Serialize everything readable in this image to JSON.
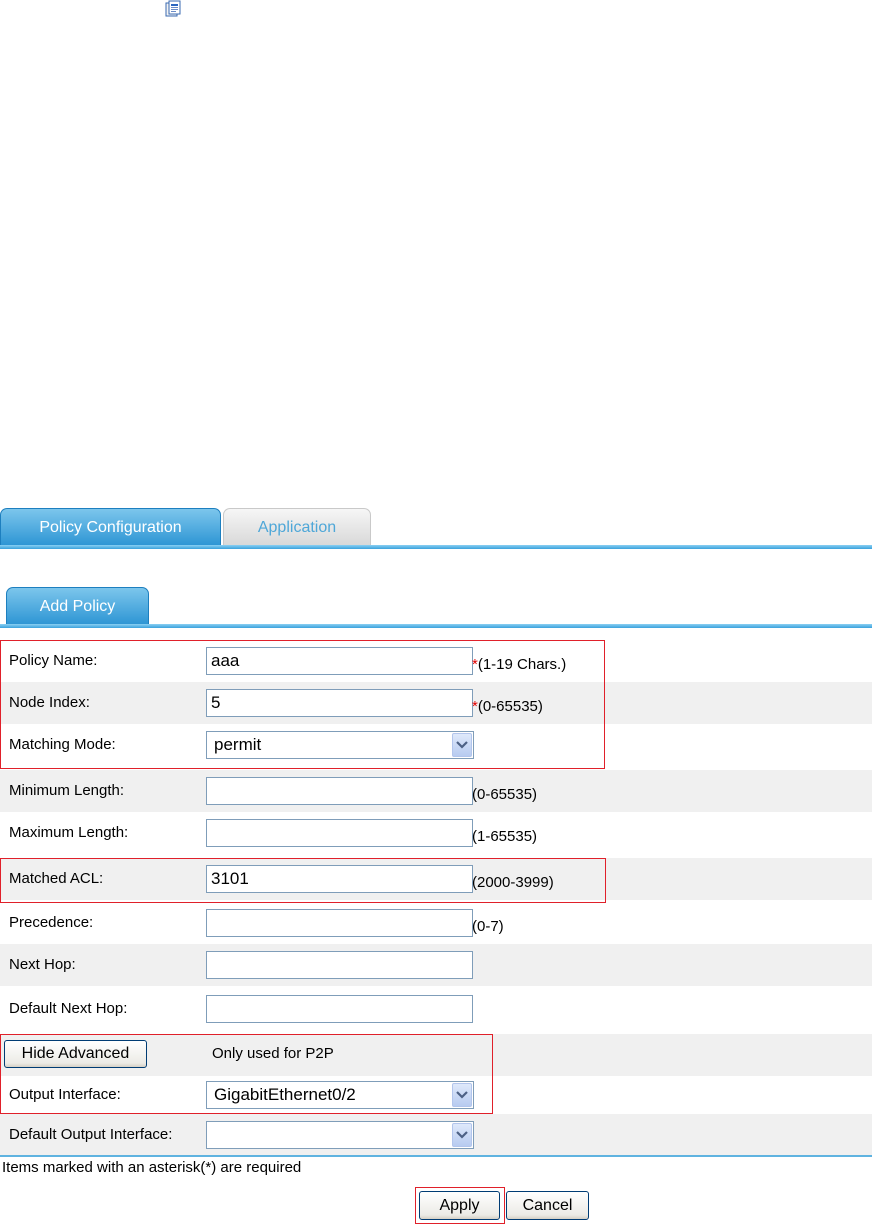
{
  "tabs": [
    {
      "label": "Policy Configuration",
      "active": true
    },
    {
      "label": "Application",
      "active": false
    }
  ],
  "subtab": {
    "label": "Add Policy"
  },
  "form": {
    "policy_name": {
      "label": "Policy Name:",
      "value": "aaa",
      "required_mark": "*",
      "hint": "(1-19 Chars.)"
    },
    "node_index": {
      "label": "Node Index:",
      "value": "5",
      "required_mark": "*",
      "hint": "(0-65535)"
    },
    "matching_mode": {
      "label": "Matching Mode:",
      "value": "permit"
    },
    "minimum_length": {
      "label": "Minimum Length:",
      "value": "",
      "hint": "(0-65535)"
    },
    "maximum_length": {
      "label": "Maximum Length:",
      "value": "",
      "hint": "(1-65535)"
    },
    "matched_acl": {
      "label": "Matched ACL:",
      "value": "3101",
      "hint": "(2000-3999)"
    },
    "precedence": {
      "label": "Precedence:",
      "value": "",
      "hint": "(0-7)"
    },
    "next_hop": {
      "label": "Next Hop:",
      "value": ""
    },
    "default_next_hop": {
      "label": "Default Next Hop:",
      "value": ""
    },
    "advanced": {
      "button_label": "Hide Advanced",
      "note": "Only used for P2P"
    },
    "output_interface": {
      "label": "Output Interface:",
      "value": "GigabitEthernet0/2"
    },
    "default_output_interface": {
      "label": "Default Output Interface:",
      "value": ""
    }
  },
  "footnote": "Items marked with an asterisk(*) are required",
  "actions": {
    "apply_label": "Apply",
    "cancel_label": "Cancel"
  },
  "colors": {
    "accent": "#2a93d3",
    "highlight": "#e0202a",
    "required": "#e00000"
  },
  "icons": {
    "top": "document-properties-icon",
    "dropdown": "chevron-down-icon"
  }
}
